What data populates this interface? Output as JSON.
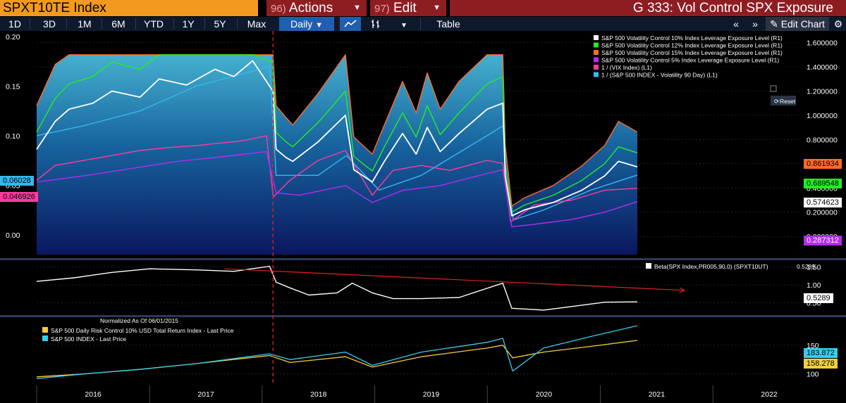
{
  "header": {
    "ticker": "SPXT10TE Index",
    "actions_num": "96)",
    "actions_label": "Actions",
    "edit_num": "97)",
    "edit_label": "Edit",
    "title": "G 333: Vol Control SPX Exposure"
  },
  "toolbar": {
    "periods": [
      "1D",
      "3D",
      "1M",
      "6M",
      "YTD",
      "1Y",
      "5Y",
      "Max"
    ],
    "frequency": "Daily",
    "table_label": "Table",
    "edit_chart_label": "Edit Chart"
  },
  "reset_label": "Reset",
  "colors": {
    "vc10": "#ffffff",
    "vc12": "#22ee22",
    "vc15": "#ff6a2a",
    "vc5": "#b22cf0",
    "vix": "#ff3ba0",
    "spxvol": "#34b8ee",
    "beta": "#ffffff",
    "trend": "#e02222",
    "riskctrl": "#f2cf3a",
    "spx": "#34cfee"
  },
  "chart_data": [
    {
      "type": "line",
      "title": "",
      "legend_position": "top-right",
      "left_axis": {
        "ylim": [
          -0.02,
          0.2
        ],
        "ticks": [
          "0.20",
          "0.15",
          "0.10",
          "0.05",
          "0.00"
        ]
      },
      "right_axis": {
        "ylim": [
          -0.15,
          1.65
        ],
        "ticks": [
          "1.600000",
          "1.400000",
          "1.200000",
          "1.000000",
          "0.800000",
          "0.600000",
          "0.400000",
          "0.200000",
          "0.000000"
        ]
      },
      "x_range": [
        "2016-01-01",
        "2022-06-30"
      ],
      "series": [
        {
          "name": "S&P 500 Volatility Control 10% Index Leverage Exposure Level (R1)",
          "axis": "R1",
          "last": "0.574623",
          "x": [
            "2016-01-01",
            "2016-03-01",
            "2016-04-15",
            "2016-07-01",
            "2016-09-01",
            "2016-12-01",
            "2017-02-01",
            "2017-05-01",
            "2017-08-01",
            "2017-10-01",
            "2017-12-01",
            "2018-02-05",
            "2018-02-15",
            "2018-03-20",
            "2018-04-10",
            "2018-07-01",
            "2018-09-28",
            "2018-10-25",
            "2018-12-24",
            "2019-02-01",
            "2019-04-01",
            "2019-05-15",
            "2019-06-20",
            "2019-08-01",
            "2019-10-01",
            "2019-12-31",
            "2020-02-20",
            "2020-02-28",
            "2020-03-20",
            "2020-05-01",
            "2020-08-01",
            "2020-11-01",
            "2021-01-15",
            "2021-03-01",
            "2021-05-01"
          ],
          "y": [
            0.72,
            0.95,
            1.05,
            1.1,
            1.2,
            1.15,
            1.3,
            1.25,
            1.38,
            1.32,
            1.45,
            1.2,
            0.72,
            0.65,
            0.62,
            0.78,
            1.0,
            0.55,
            0.45,
            0.62,
            0.85,
            0.68,
            0.9,
            0.7,
            0.85,
            1.05,
            1.1,
            0.5,
            0.17,
            0.22,
            0.28,
            0.38,
            0.5,
            0.62,
            0.574623
          ]
        },
        {
          "name": "S&P 500 Volatility Control 12% Index Leverage Exposure Level (R1)",
          "axis": "R1",
          "last": "0.689548",
          "x": [
            "2016-01-01",
            "2016-03-01",
            "2016-04-15",
            "2016-07-01",
            "2016-09-01",
            "2016-12-01",
            "2017-02-01",
            "2017-05-01",
            "2017-08-01",
            "2017-10-01",
            "2017-12-01",
            "2018-02-05",
            "2018-02-15",
            "2018-03-20",
            "2018-04-10",
            "2018-07-01",
            "2018-09-28",
            "2018-10-25",
            "2018-12-24",
            "2019-02-01",
            "2019-04-01",
            "2019-05-15",
            "2019-06-20",
            "2019-08-01",
            "2019-10-01",
            "2019-12-31",
            "2020-02-20",
            "2020-02-28",
            "2020-03-20",
            "2020-05-01",
            "2020-08-01",
            "2020-11-01",
            "2021-01-15",
            "2021-03-01",
            "2021-05-01"
          ],
          "y": [
            0.86,
            1.14,
            1.26,
            1.32,
            1.44,
            1.38,
            1.5,
            1.5,
            1.5,
            1.5,
            1.5,
            1.44,
            0.86,
            0.78,
            0.74,
            0.94,
            1.2,
            0.66,
            0.54,
            0.74,
            1.02,
            0.82,
            1.08,
            0.84,
            1.02,
            1.26,
            1.32,
            0.6,
            0.2,
            0.26,
            0.34,
            0.46,
            0.6,
            0.74,
            0.689548
          ]
        },
        {
          "name": "S&P 500 Volatility Control 15% Index Leverage Exposure Level (R1)",
          "axis": "R1",
          "last": "0.861934",
          "x": [
            "2016-01-01",
            "2016-03-01",
            "2016-04-15",
            "2016-07-01",
            "2016-09-01",
            "2016-12-01",
            "2017-02-01",
            "2017-05-01",
            "2017-08-01",
            "2017-10-01",
            "2017-12-01",
            "2018-02-05",
            "2018-02-15",
            "2018-03-20",
            "2018-04-10",
            "2018-07-01",
            "2018-09-28",
            "2018-10-25",
            "2018-12-24",
            "2019-02-01",
            "2019-04-01",
            "2019-05-15",
            "2019-06-20",
            "2019-08-01",
            "2019-10-01",
            "2019-12-31",
            "2020-02-20",
            "2020-02-28",
            "2020-03-20",
            "2020-05-01",
            "2020-08-01",
            "2020-11-01",
            "2021-01-15",
            "2021-03-01",
            "2021-05-01"
          ],
          "y": [
            1.08,
            1.42,
            1.5,
            1.5,
            1.5,
            1.5,
            1.5,
            1.5,
            1.5,
            1.5,
            1.5,
            1.5,
            1.08,
            0.98,
            0.92,
            1.18,
            1.5,
            0.82,
            0.68,
            0.92,
            1.28,
            1.02,
            1.35,
            1.05,
            1.28,
            1.5,
            1.5,
            0.75,
            0.25,
            0.32,
            0.42,
            0.58,
            0.75,
            0.95,
            0.861934
          ]
        },
        {
          "name": "S&P 500 Volatility Control 5% Index Leverage Exposure Level (R1)",
          "axis": "R1",
          "last": "0.287312",
          "x": [
            "2016-01-01",
            "2016-06-01",
            "2016-11-01",
            "2017-04-01",
            "2017-09-01",
            "2018-01-15",
            "2018-02-15",
            "2018-05-01",
            "2018-09-28",
            "2018-12-24",
            "2019-04-01",
            "2019-08-01",
            "2019-12-31",
            "2020-02-20",
            "2020-03-20",
            "2020-06-01",
            "2020-10-01",
            "2021-01-15",
            "2021-05-01"
          ],
          "y": [
            0.45,
            0.5,
            0.56,
            0.62,
            0.66,
            0.7,
            0.36,
            0.34,
            0.42,
            0.28,
            0.38,
            0.42,
            0.52,
            0.55,
            0.08,
            0.1,
            0.14,
            0.2,
            0.287312
          ]
        },
        {
          "name": "1 / (VIX Index) (L1)",
          "axis": "L1",
          "last": "0.046926",
          "x": [
            "2016-01-01",
            "2016-03-01",
            "2016-06-01",
            "2016-09-01",
            "2016-12-01",
            "2017-03-01",
            "2017-06-01",
            "2017-09-01",
            "2017-11-01",
            "2018-01-15",
            "2018-02-06",
            "2018-04-01",
            "2018-07-01",
            "2018-09-28",
            "2018-12-24",
            "2019-03-01",
            "2019-06-01",
            "2019-09-01",
            "2019-12-31",
            "2020-02-20",
            "2020-03-16",
            "2020-06-01",
            "2020-10-01",
            "2021-01-15",
            "2021-05-01"
          ],
          "y": [
            0.055,
            0.07,
            0.075,
            0.08,
            0.085,
            0.088,
            0.09,
            0.093,
            0.095,
            0.1,
            0.038,
            0.055,
            0.075,
            0.085,
            0.04,
            0.065,
            0.07,
            0.065,
            0.075,
            0.072,
            0.013,
            0.03,
            0.035,
            0.045,
            0.046926
          ]
        },
        {
          "name": "1 / (S&P 500 INDEX - Volatility 90 Day) (L1)",
          "axis": "L1",
          "last": "0.06028",
          "x": [
            "2016-01-01",
            "2016-06-01",
            "2016-12-01",
            "2017-06-01",
            "2017-12-01",
            "2018-01-25",
            "2018-02-15",
            "2018-07-01",
            "2018-10-01",
            "2019-01-15",
            "2019-06-01",
            "2019-12-31",
            "2020-02-20",
            "2020-03-25",
            "2020-07-01",
            "2020-12-01",
            "2021-05-01"
          ],
          "y": [
            0.1,
            0.11,
            0.125,
            0.15,
            0.165,
            0.17,
            0.06,
            0.06,
            0.08,
            0.045,
            0.06,
            0.1,
            0.11,
            0.015,
            0.025,
            0.045,
            0.06028
          ]
        }
      ]
    },
    {
      "type": "line",
      "legend_position": "top-right",
      "right_axis": {
        "ylim": [
          0.2,
          1.65
        ],
        "ticks": [
          "1.50",
          "1.00",
          "0.50"
        ]
      },
      "series": [
        {
          "name": "Beta(SPX Index,PR005,90,0) (SPXT10UT)",
          "last": "0.5289",
          "x": [
            "2016-01-01",
            "2016-05-01",
            "2016-09-01",
            "2017-01-01",
            "2017-06-01",
            "2017-10-01",
            "2018-01-25",
            "2018-02-15",
            "2018-04-01",
            "2018-06-01",
            "2018-09-01",
            "2018-10-20",
            "2018-12-24",
            "2019-03-01",
            "2019-06-01",
            "2019-10-01",
            "2020-02-20",
            "2020-03-20",
            "2020-07-01",
            "2020-10-01",
            "2021-01-15",
            "2021-05-01"
          ],
          "y": [
            1.1,
            1.2,
            1.35,
            1.45,
            1.42,
            1.38,
            1.52,
            1.08,
            0.92,
            0.72,
            0.78,
            1.05,
            0.78,
            0.62,
            0.62,
            0.65,
            1.05,
            0.35,
            0.3,
            0.4,
            0.52,
            0.5289
          ]
        }
      ],
      "annotation": {
        "type": "trend-arrow",
        "from": [
          "2017-09-01",
          1.45
        ],
        "to": [
          "2021-10-01",
          0.85
        ]
      }
    },
    {
      "type": "line",
      "title": "Normalized As Of 06/01/2015",
      "legend_position": "top-left",
      "right_axis": {
        "ticks": [
          "150",
          "100"
        ]
      },
      "series": [
        {
          "name": "S&P 500 Daily Risk Control 10% USD Total Return Index - Last Price",
          "last": "158.278",
          "x": [
            "2016-01-01",
            "2016-06-01",
            "2016-12-01",
            "2017-06-01",
            "2018-01-25",
            "2018-04-01",
            "2018-09-28",
            "2018-12-24",
            "2019-06-01",
            "2019-12-31",
            "2020-02-20",
            "2020-03-23",
            "2020-07-01",
            "2020-12-01",
            "2021-05-01"
          ],
          "y": [
            95,
            100,
            108,
            118,
            132,
            120,
            130,
            112,
            130,
            145,
            150,
            128,
            138,
            148,
            158.278
          ]
        },
        {
          "name": "S&P 500 INDEX - Last Price",
          "last": "183.872",
          "x": [
            "2016-01-01",
            "2016-06-01",
            "2016-12-01",
            "2017-06-01",
            "2018-01-25",
            "2018-04-01",
            "2018-09-28",
            "2018-12-24",
            "2019-06-01",
            "2019-12-31",
            "2020-02-20",
            "2020-03-23",
            "2020-07-01",
            "2020-12-01",
            "2021-05-01"
          ],
          "y": [
            92,
            100,
            108,
            118,
            135,
            125,
            138,
            115,
            138,
            155,
            162,
            105,
            145,
            165,
            183.872
          ]
        }
      ]
    }
  ],
  "x_axis": {
    "years": [
      "2016",
      "2017",
      "2018",
      "2019",
      "2020",
      "2021",
      "2022"
    ]
  },
  "event_marker": {
    "date": "2018-02-05"
  }
}
